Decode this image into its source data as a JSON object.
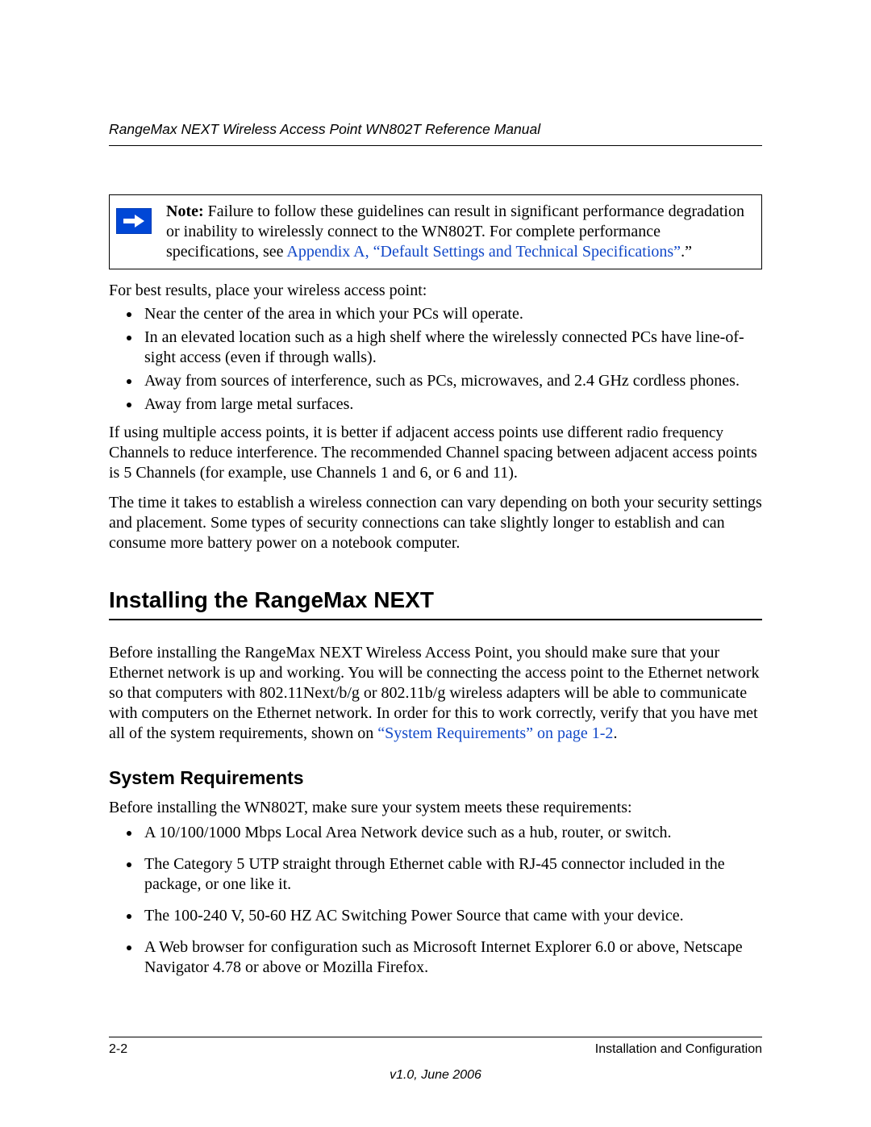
{
  "header": {
    "title": "RangeMax NEXT Wireless Access Point WN802T Reference Manual"
  },
  "note": {
    "label": "Note:",
    "text_before_link": " Failure to follow these guidelines can result in significant performance degradation or inability to wirelessly connect to the WN802T. For complete performance specifications, see ",
    "link": "Appendix A, “Default Settings and Technical Specifications”",
    "after_link": ".”"
  },
  "body": {
    "intro_best_results": "For best results, place your wireless access point:",
    "bullets1": [
      "Near the center of the area in which your PCs will operate.",
      "In an elevated location such as a high shelf where the wirelessly connected PCs have line-of-sight access (even if through walls).",
      "Away from sources of interference, such as PCs, microwaves, and 2.4 GHz cordless phones.",
      "Away from large metal surfaces."
    ],
    "para_multi_ap_a": "If using multiple access points, it is better if adjacent access points use different ",
    "para_multi_ap_term": "radio frequency",
    "para_multi_ap_b": " Channels to reduce interference. The recommended Channel spacing between adjacent access points is 5 Channels (for example, use Channels 1 and 6, or 6 and 11).",
    "para_time": "The time it takes to establish a wireless connection can vary depending on both your security settings and placement. Some types of security connections can take slightly longer to establish and can consume more battery power on a notebook computer.",
    "h1_install": "Installing the RangeMax NEXT",
    "para_install_before_link": "Before installing the RangeMax NEXT Wireless Access Point, you should make sure that your Ethernet network is up and working. You will be connecting the access point to the Ethernet network so that computers with 802.11Next/b/g or 802.11b/g wireless adapters will be able to communicate with computers on the Ethernet network. In order for this to work correctly, verify that you have met all of the system requirements, shown on ",
    "para_install_link": "“System Requirements” on page 1-2",
    "para_install_after_link": ".",
    "h2_sysreq": "System Requirements",
    "sysreq_intro": "Before installing the WN802T, make sure your system meets these requirements:",
    "bullets2": [
      "A 10/100/1000 Mbps Local Area Network device such as a hub, router, or switch.",
      "The Category 5 UTP straight through Ethernet cable with RJ-45 connector included in the package, or one like it.",
      "The 100-240 V, 50-60 HZ AC Switching Power Source that came with your device.",
      "A Web browser for configuration such as Microsoft Internet Explorer 6.0 or above, Netscape Navigator 4.78 or above or Mozilla Firefox."
    ]
  },
  "footer": {
    "page": "2-2",
    "section": "Installation and Configuration",
    "version": "v1.0, June 2006"
  }
}
